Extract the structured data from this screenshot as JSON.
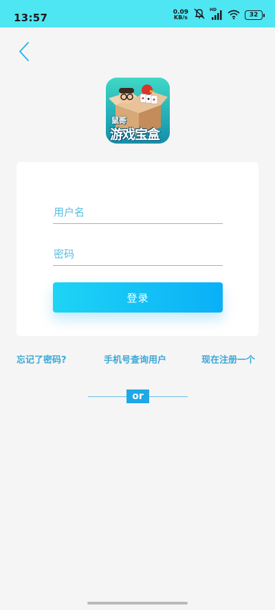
{
  "status_bar": {
    "time": "13:57",
    "net_speed_value": "0.09",
    "net_speed_unit": "KB/s",
    "hd_label": "HD",
    "battery": "32"
  },
  "logo": {
    "top_text": "鼠哥",
    "main_text": "游戏宝盒"
  },
  "form": {
    "username_placeholder": "用户名",
    "password_placeholder": "密码",
    "login_label": "登录"
  },
  "links": {
    "forgot_password": "忘记了密码?",
    "phone_lookup": "手机号查询用户",
    "register": "现在注册一个"
  },
  "divider": {
    "label": "or"
  },
  "colors": {
    "accent": "#1ea8e5",
    "status_bar": "#4ee6f2",
    "link": "#3aa8d7",
    "placeholder": "#53bfe3"
  }
}
